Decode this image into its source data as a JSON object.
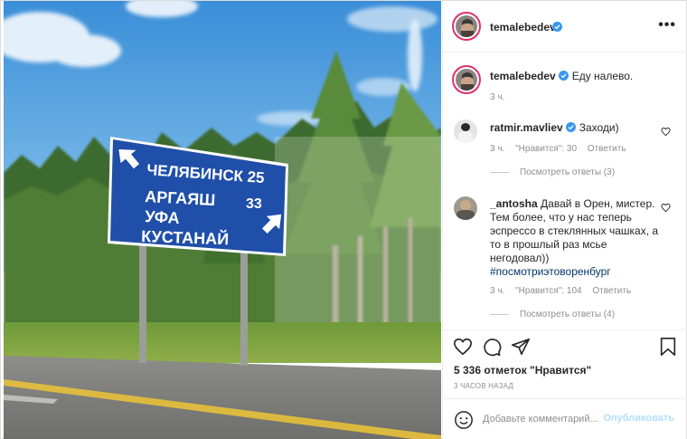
{
  "post": {
    "author": "temalebedev",
    "caption": "Еду налево.",
    "caption_time": "3 ч.",
    "likes": "5 336 отметок \"Нравится\"",
    "time_ago": "3 ЧАСОВ НАЗАД"
  },
  "sign": {
    "line1": "ЧЕЛЯБИНСК 25",
    "line2": "АРГАЯШ",
    "line2_num": "33",
    "line3": "УФА",
    "line4": "КУСТАНАЙ"
  },
  "comments": [
    {
      "user": "ratmir.mavliev",
      "verified": true,
      "text": "Заходи)",
      "time": "3 ч.",
      "likes": "\"Нравится\": 30",
      "reply": "Ответить",
      "view_replies": "Посмотреть ответы (3)"
    },
    {
      "user": "_antosha",
      "verified": false,
      "text_lines": [
        "Давай в Орен, мистер.",
        "Тем более, что у нас теперь",
        "эспрессо в стеклянных чашках, а",
        "то в прошлый раз мсье",
        "негодовал))"
      ],
      "hashtag": "#посмотриэтоворенбург",
      "time": "3 ч.",
      "likes": "\"Нравится\": 104",
      "reply": "Ответить",
      "view_replies": "Посмотреть ответы (4)"
    }
  ],
  "add_comment": {
    "placeholder": "Добавьте комментарий...",
    "post_label": "Опубликовать"
  },
  "icons": {
    "more": "more-options-icon",
    "verified": "verified-badge-icon",
    "like": "heart-icon",
    "comment": "comment-icon",
    "share": "paper-plane-icon",
    "save": "bookmark-icon",
    "emoji": "emoji-icon"
  },
  "colors": {
    "verified": "#3897f0",
    "sign_blue": "#1f4fa8",
    "post_button_disabled": "#b2dffc",
    "hashtag": "#00376b"
  }
}
